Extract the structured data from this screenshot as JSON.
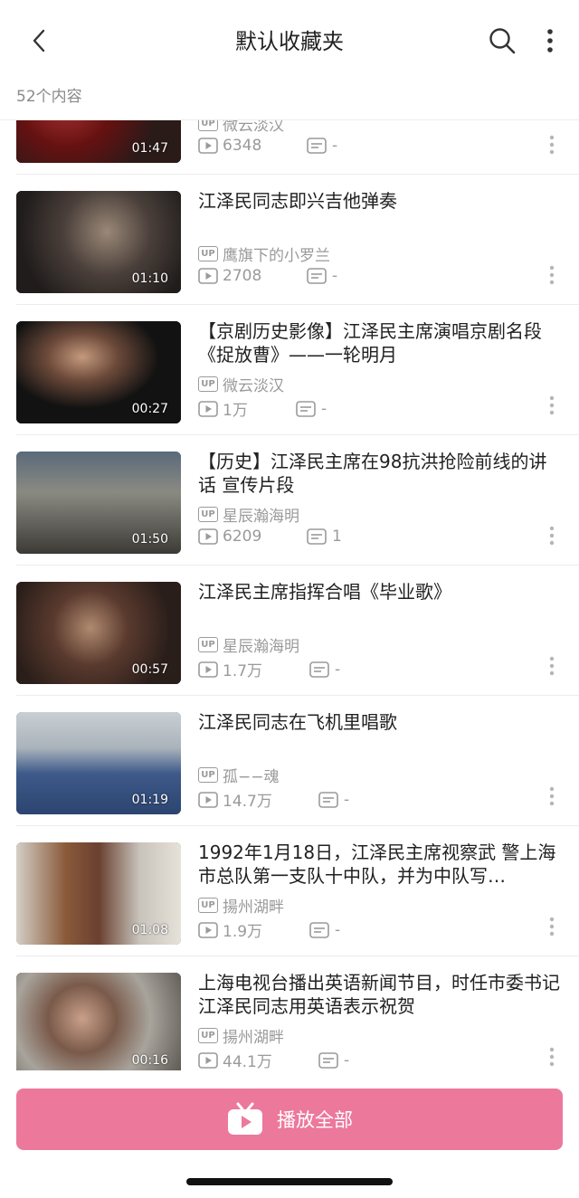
{
  "header": {
    "title": "默认收藏夹"
  },
  "summary": {
    "count_label": "52个内容"
  },
  "items": [
    {
      "title": "",
      "uploader": "微云淡汉",
      "plays": "6348",
      "danmaku": "-",
      "duration": "01:47"
    },
    {
      "title": "江泽民同志即兴吉他弹奏",
      "uploader": "鹰旗下的小罗兰",
      "plays": "2708",
      "danmaku": "-",
      "duration": "01:10"
    },
    {
      "title": "【京剧历史影像】江泽民主席演唱京剧名段《捉放曹》——一轮明月",
      "uploader": "微云淡汉",
      "plays": "1万",
      "danmaku": "-",
      "duration": "00:27"
    },
    {
      "title": "【历史】江泽民主席在98抗洪抢险前线的讲话 宣传片段",
      "uploader": "星辰瀚海明",
      "plays": "6209",
      "danmaku": "1",
      "duration": "01:50"
    },
    {
      "title": "江泽民主席指挥合唱《毕业歌》",
      "uploader": "星辰瀚海明",
      "plays": "1.7万",
      "danmaku": "-",
      "duration": "00:57"
    },
    {
      "title": "江泽民同志在飞机里唱歌",
      "uploader": "孤−−魂",
      "plays": "14.7万",
      "danmaku": "-",
      "duration": "01:19"
    },
    {
      "title": "1992年1月18日，江泽民主席视察武 警上海市总队第一支队十中队，并为中队写…",
      "uploader": "揚州湖畔",
      "plays": "1.9万",
      "danmaku": "-",
      "duration": "01:08"
    },
    {
      "title": "上海电视台播出英语新闻节目，时任市委书记江泽民同志用英语表示祝贺",
      "uploader": "揚州湖畔",
      "plays": "44.1万",
      "danmaku": "-",
      "duration": "00:16"
    }
  ],
  "badge": {
    "up_label": "UP"
  },
  "footer": {
    "play_all_label": "播放全部"
  },
  "colors": {
    "accent": "#ec789c",
    "meta_text": "#9a9a9a"
  },
  "icons": {
    "back": "chevron-left-icon",
    "search": "search-icon",
    "more": "more-vertical-icon",
    "play_count": "play-count-icon",
    "danmaku": "danmaku-icon",
    "tv": "tv-play-icon"
  }
}
